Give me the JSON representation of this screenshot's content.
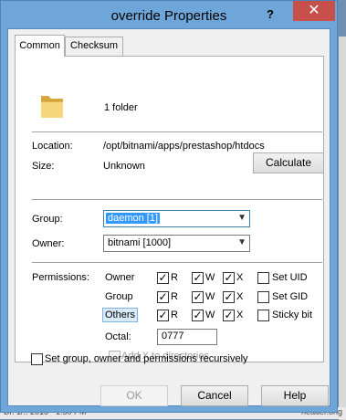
{
  "window": {
    "title": "override Properties",
    "help_glyph": "?",
    "close_glyph": "✕"
  },
  "tabs": [
    {
      "label": "Common",
      "active": true
    },
    {
      "label": "Checksum",
      "active": false
    }
  ],
  "info": {
    "folder_count": "1 folder",
    "location_label": "Location:",
    "location_value": "/opt/bitnami/apps/prestashop/htdocs",
    "size_label": "Size:",
    "size_value": "Unknown",
    "calculate_label": "Calculate"
  },
  "ownership": {
    "group_label": "Group:",
    "group_value": "daemon [1]",
    "owner_label": "Owner:",
    "owner_value": "bitnami [1000]"
  },
  "permissions": {
    "label": "Permissions:",
    "rows": [
      {
        "name": "Owner",
        "r": true,
        "w": true,
        "x": true,
        "extra": "Set UID",
        "extra_checked": false
      },
      {
        "name": "Group",
        "r": true,
        "w": true,
        "x": true,
        "extra": "Set GID",
        "extra_checked": false
      },
      {
        "name": "Others",
        "r": true,
        "w": true,
        "x": true,
        "extra": "Sticky bit",
        "extra_checked": false
      }
    ],
    "r_label": "R",
    "w_label": "W",
    "x_label": "X",
    "octal_label": "Octal:",
    "octal_value": "0777",
    "add_x_label": "Add X to directories"
  },
  "recursive_label": "Set group, owner and permissions recursively",
  "buttons": {
    "ok": "OK",
    "cancel": "Cancel",
    "help": "Help"
  },
  "background": {
    "text_left": "Dr. 1/.. 2015 · 1:50 PM",
    "text_right": "header.ong"
  }
}
